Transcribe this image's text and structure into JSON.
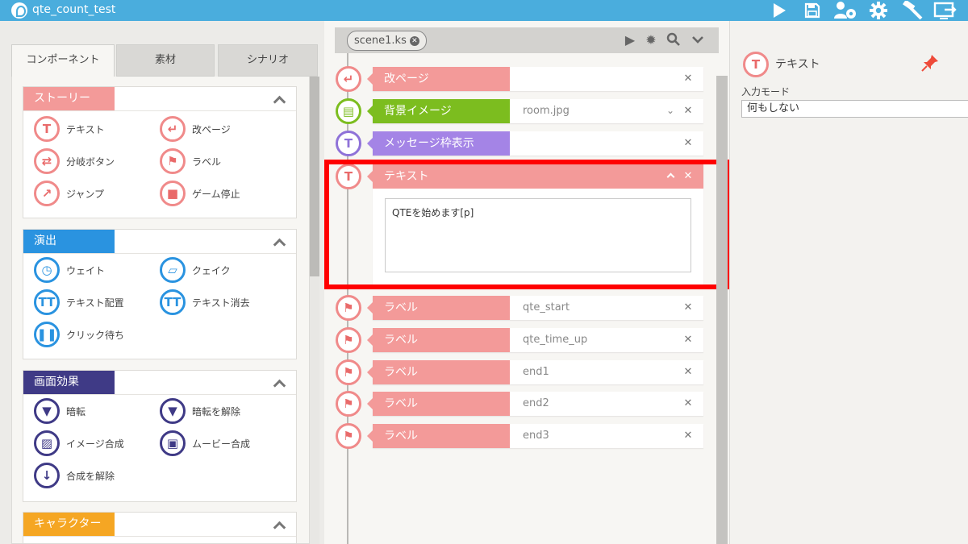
{
  "app": {
    "title": "qte_count_test"
  },
  "toolbar": {
    "icons": [
      "play-icon",
      "save-icon",
      "user-settings-icon",
      "gear-icon",
      "hammer-icon",
      "export-icon"
    ]
  },
  "left": {
    "tabs": [
      {
        "label": "コンポーネント",
        "active": true
      },
      {
        "label": "素材",
        "active": false
      },
      {
        "label": "シナリオ",
        "active": false
      }
    ],
    "groups": [
      {
        "title": "ストーリー",
        "color": "#f39a99",
        "items": [
          {
            "label": "テキスト",
            "icon": "text-icon"
          },
          {
            "label": "改ページ",
            "icon": "page-break-icon"
          },
          {
            "label": "分岐ボタン",
            "icon": "branch-button-icon"
          },
          {
            "label": "ラベル",
            "icon": "label-flag-icon"
          },
          {
            "label": "ジャンプ",
            "icon": "jump-icon"
          },
          {
            "label": "ゲーム停止",
            "icon": "game-stop-icon"
          }
        ]
      },
      {
        "title": "演出",
        "color": "#2a93e0",
        "items": [
          {
            "label": "ウェイト",
            "icon": "wait-icon"
          },
          {
            "label": "クェイク",
            "icon": "quake-icon"
          },
          {
            "label": "テキスト配置",
            "icon": "text-place-icon"
          },
          {
            "label": "テキスト消去",
            "icon": "text-erase-icon"
          },
          {
            "label": "クリック待ち",
            "icon": "click-wait-icon"
          }
        ]
      },
      {
        "title": "画面効果",
        "color": "#3f3a86",
        "items": [
          {
            "label": "暗転",
            "icon": "blackout-icon"
          },
          {
            "label": "暗転を解除",
            "icon": "blackout-release-icon"
          },
          {
            "label": "イメージ合成",
            "icon": "image-composite-icon"
          },
          {
            "label": "ムービー合成",
            "icon": "movie-composite-icon"
          },
          {
            "label": "合成を解除",
            "icon": "composite-release-icon"
          }
        ]
      },
      {
        "title": "キャラクター",
        "color": "#f5a623",
        "items": []
      }
    ]
  },
  "center": {
    "scene_tab": "scene1.ks",
    "rows": [
      {
        "label": "改ページ",
        "value": "",
        "color": "#f39a99",
        "icon_color": "#f08a8a"
      },
      {
        "label": "背景イメージ",
        "value": "room.jpg",
        "color": "#7cbd1f",
        "icon_color": "#7cbd1f"
      },
      {
        "label": "メッセージ枠表示",
        "value": "",
        "color": "#a484e6",
        "icon_color": "#8f72d8"
      },
      {
        "label": "ラベル",
        "value": "qte_start",
        "color": "#f39a99",
        "icon_color": "#f08a8a"
      },
      {
        "label": "ラベル",
        "value": "qte_time_up",
        "color": "#f39a99",
        "icon_color": "#f08a8a"
      },
      {
        "label": "ラベル",
        "value": "end1",
        "color": "#f39a99",
        "icon_color": "#f08a8a"
      },
      {
        "label": "ラベル",
        "value": "end2",
        "color": "#f39a99",
        "icon_color": "#f08a8a"
      },
      {
        "label": "ラベル",
        "value": "end3",
        "color": "#f39a99",
        "icon_color": "#f08a8a"
      }
    ],
    "text_block": {
      "label": "テキスト",
      "content": "QTEを始めます[p]"
    }
  },
  "right": {
    "title": "テキスト",
    "mode_label": "入力モード",
    "mode_value": "何もしない"
  }
}
